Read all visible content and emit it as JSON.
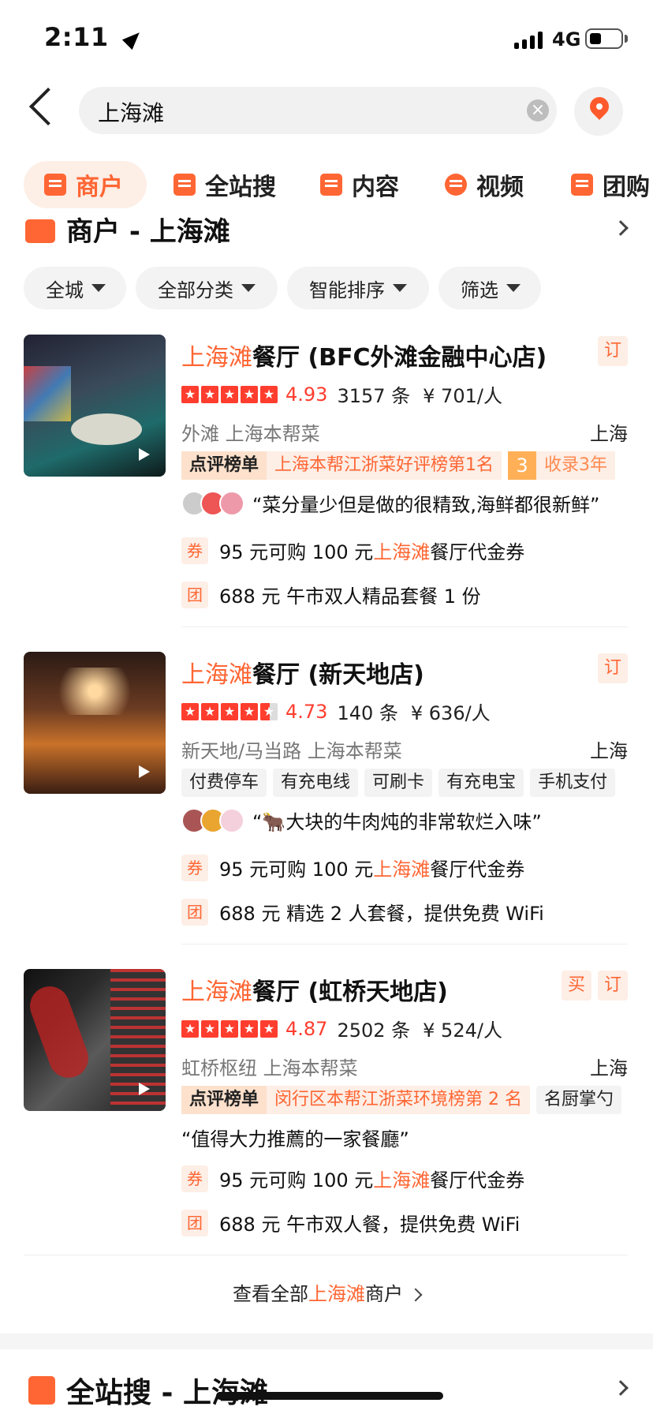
{
  "status_bar": {
    "time": "2:11",
    "network": "4G"
  },
  "search": {
    "query": "上海滩",
    "clear_icon": "×"
  },
  "tabs": [
    {
      "label": "商户",
      "icon": "storefront-icon"
    },
    {
      "label": "全站搜",
      "icon": "document-icon"
    },
    {
      "label": "内容",
      "icon": "comment-icon"
    },
    {
      "label": "视频",
      "icon": "play-icon"
    },
    {
      "label": "团购",
      "icon": "ticket-icon"
    }
  ],
  "section": {
    "title": "商户 - 上海滩"
  },
  "filters": [
    "全城",
    "全部分类",
    "智能排序",
    "筛选"
  ],
  "restaurants": [
    {
      "name_hl": "上海滩",
      "name_rest": "餐厅 (BFC外滩金融中心店)",
      "badges": [
        "订"
      ],
      "score": "4.93",
      "reviews": "3157 条",
      "price": "¥ 701/人",
      "area": "外滩  上海本帮菜",
      "city": "上海",
      "rank_label": "点评榜单",
      "rank_text": "上海本帮江浙菜好评榜第1名",
      "years_num": "3",
      "years_text": "收录3年",
      "quote": "“菜分量少但是做的很精致,海鲜都很新鲜”",
      "voucher_pre": "95 元可购 100 元",
      "voucher_hl": "上海滩",
      "voucher_post": "餐厅代金券",
      "voucher_icon": "券",
      "group_icon": "团",
      "group_text": "688 元  午市双人精品套餐 1 份"
    },
    {
      "name_hl": "上海滩",
      "name_rest": "餐厅 (新天地店)",
      "badges": [
        "订"
      ],
      "score": "4.73",
      "reviews": "140 条",
      "price": "¥ 636/人",
      "area": "新天地/马当路  上海本帮菜",
      "city": "上海",
      "facilities": [
        "付费停车",
        "有充电线",
        "可刷卡",
        "有充电宝",
        "手机支付"
      ],
      "quote": "“🐂大块的牛肉炖的非常软烂入味”",
      "voucher_pre": "95 元可购 100 元",
      "voucher_hl": "上海滩",
      "voucher_post": "餐厅代金券",
      "voucher_icon": "券",
      "group_icon": "团",
      "group_text": "688 元  精选 2 人套餐，提供免费 WiFi"
    },
    {
      "name_hl": "上海滩",
      "name_rest": "餐厅 (虹桥天地店)",
      "badges": [
        "买",
        "订"
      ],
      "score": "4.87",
      "reviews": "2502 条",
      "price": "¥ 524/人",
      "area": "虹桥枢纽  上海本帮菜",
      "city": "上海",
      "rank_label": "点评榜单",
      "rank_text": "闵行区本帮江浙菜环境榜第 2 名",
      "extra_tag": "名厨掌勺",
      "quote": "“值得大力推薦的一家餐廳”",
      "voucher_pre": "95 元可购 100 元",
      "voucher_hl": "上海滩",
      "voucher_post": "餐厅代金券",
      "voucher_icon": "券",
      "group_icon": "团",
      "group_text": "688 元  午市双人餐，提供免费 WiFi"
    }
  ],
  "view_all": {
    "pre": "查看全部",
    "hl": "上海滩",
    "post": "商户"
  },
  "section2": {
    "title": "全站搜 - 上海滩"
  },
  "colors": {
    "accent": "#ff6633",
    "star": "#ff3d2e"
  }
}
